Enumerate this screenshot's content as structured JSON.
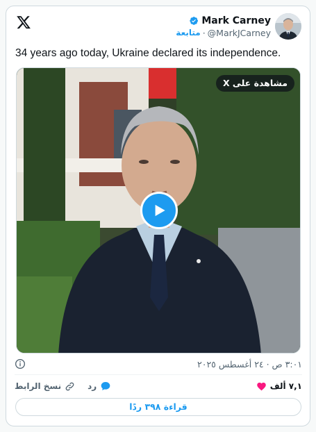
{
  "author": {
    "display_name": "Mark Carney",
    "handle": "@MarkJCarney",
    "follow_label": "متابعة",
    "separator": "·"
  },
  "tweet": {
    "text": "34 years ago today, Ukraine declared its independence."
  },
  "media": {
    "watch_label": "مشاهدة على X"
  },
  "meta": {
    "timestamp": "٣:٠١ ص · ٢٤ أغسطس ٢٠٢٥"
  },
  "actions": {
    "likes_count": "٧,١ ألف",
    "reply_label": "رد",
    "copy_link_label": "نسخ الرابط"
  },
  "read_replies_label": "قراءة ٣٩٨ ردًا",
  "colors": {
    "accent": "#1d9bf0",
    "like": "#f91880",
    "text": "#0f1419",
    "muted": "#536471"
  },
  "icons": [
    "x-logo-icon",
    "verified-badge-icon",
    "play-icon",
    "info-icon",
    "heart-icon",
    "reply-icon",
    "link-icon"
  ]
}
